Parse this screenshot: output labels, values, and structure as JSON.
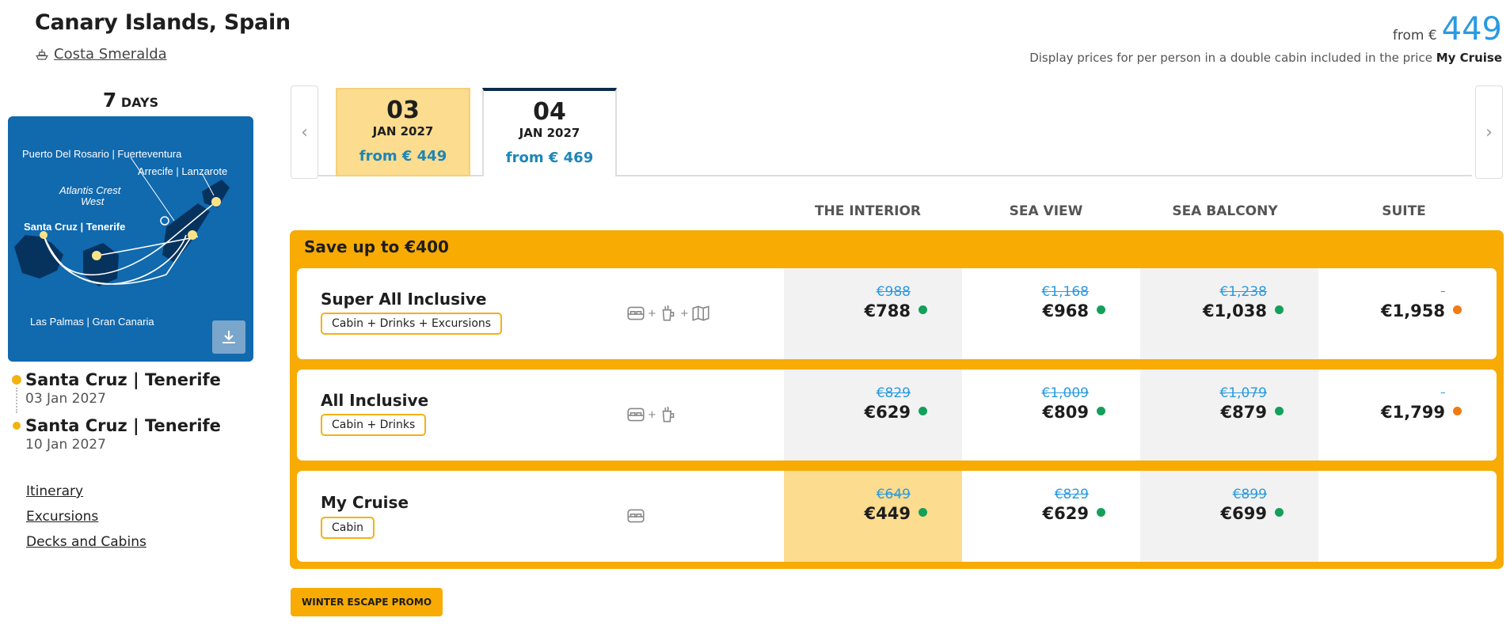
{
  "header": {
    "title": "Canary Islands, Spain",
    "ship": "Costa Smeralda",
    "from_label": "from €",
    "from_value": "449",
    "disclaimer_text": "Display prices for per person in a double cabin included in the price",
    "disclaimer_bold": "My Cruise"
  },
  "sidebar": {
    "days_number": "7",
    "days_unit": "DAYS",
    "map_labels": {
      "puerto": "Puerto Del Rosario | Fuerteventura",
      "arrecife": "Arrecife | Lanzarote",
      "atlantis1": "Atlantis Crest",
      "atlantis2": "West",
      "santa_cruz": "Santa Cruz | Tenerife",
      "las_palmas": "Las Palmas | Gran Canaria"
    },
    "departure": {
      "port": "Santa Cruz | Tenerife",
      "date": "03 Jan 2027"
    },
    "arrival": {
      "port": "Santa Cruz | Tenerife",
      "date": "10 Jan 2027"
    },
    "links": [
      "Itinerary",
      "Excursions",
      "Decks and Cabins"
    ]
  },
  "dates": [
    {
      "day": "03",
      "month": "JAN 2027",
      "price": "from € 449",
      "selected": true
    },
    {
      "day": "04",
      "month": "JAN 2027",
      "price": "from € 469",
      "selected": false
    }
  ],
  "columns": [
    "THE INTERIOR",
    "SEA VIEW",
    "SEA BALCONY",
    "SUITE"
  ],
  "promo": {
    "title": "Save up to €400",
    "badge": "WINTER ESCAPE PROMO"
  },
  "fares": [
    {
      "name": "Super All Inclusive",
      "tag": "Cabin + Drinks + Excursions",
      "prices": [
        {
          "old": "€988",
          "new": "€788",
          "status": "available"
        },
        {
          "old": "€1,168",
          "new": "€968",
          "status": "available"
        },
        {
          "old": "€1,238",
          "new": "€1,038",
          "status": "available"
        },
        {
          "old": "",
          "new": "€1,958",
          "status": "limited"
        }
      ]
    },
    {
      "name": "All Inclusive",
      "tag": "Cabin + Drinks",
      "prices": [
        {
          "old": "€829",
          "new": "€629",
          "status": "available"
        },
        {
          "old": "€1,009",
          "new": "€809",
          "status": "available"
        },
        {
          "old": "€1,079",
          "new": "€879",
          "status": "available"
        },
        {
          "old": "",
          "new": "€1,799",
          "status": "limited"
        }
      ]
    },
    {
      "name": "My Cruise",
      "tag": "Cabin",
      "prices": [
        {
          "old": "€649",
          "new": "€449",
          "status": "available"
        },
        {
          "old": "€829",
          "new": "€629",
          "status": "available"
        },
        {
          "old": "€899",
          "new": "€699",
          "status": "available"
        }
      ]
    }
  ],
  "colors": {
    "accent": "#f7ab03",
    "price_blue": "#2a9ae0",
    "available": "#14a05a",
    "limited": "#f07a14",
    "selected_date": "#fcdc8e"
  }
}
